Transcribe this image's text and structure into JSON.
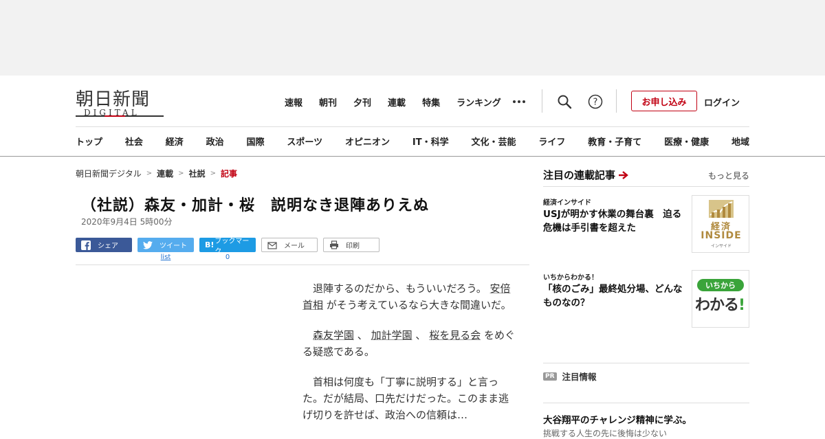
{
  "header": {
    "logo_kanji": "朝日新聞",
    "logo_sub": "DIGITAL",
    "top_nav": [
      "速報",
      "朝刊",
      "夕刊",
      "連載",
      "特集",
      "ランキング"
    ],
    "apply_label": "お申し込み",
    "login_label": "ログイン"
  },
  "category_nav": [
    "トップ",
    "社会",
    "経済",
    "政治",
    "国際",
    "スポーツ",
    "オピニオン",
    "IT・科学",
    "文化・芸能",
    "ライフ",
    "教育・子育て",
    "医療・健康",
    "地域"
  ],
  "breadcrumb": {
    "home": "朝日新聞デジタル",
    "serial": "連載",
    "editorial": "社説",
    "current": "記事"
  },
  "article": {
    "title": "（社説）森友・加計・桜　説明なき退陣ありえぬ",
    "date": "2020年9月4日 5時00分",
    "paragraph1_pre": "退陣するのだから、もういいだろう。",
    "paragraph1_link": "安倍首相",
    "paragraph1_post": "がそう考えているなら大きな間違いだ。",
    "paragraph2_link1": "森友学園",
    "paragraph2_sep1": "、",
    "paragraph2_link2": "加計学園",
    "paragraph2_sep2": "、",
    "paragraph2_link3": "桜を見る会",
    "paragraph2_post": "をめぐる疑惑である。",
    "paragraph3": "首相は何度も「丁寧に説明する」と言った。だが結局、口先だけだった。このまま逃げ切りを許せば、政治への信頼は…"
  },
  "share": {
    "facebook": "シェア",
    "twitter": "ツイート",
    "hatena": "ブックマーク",
    "mail": "メール",
    "print": "印刷",
    "twitter_count": "list",
    "hatena_count": "0"
  },
  "sidebar": {
    "heading": "注目の連載記事",
    "more": "もっと見る",
    "cards": [
      {
        "kicker": "経済インサイド",
        "title": "USJが明かす休業の舞台裏　迫る危機は手引書を超えた",
        "thumb_main": "経済",
        "thumb_sub": "INSIDE",
        "thumb_caption": "インサイド"
      },
      {
        "kicker": "いちからわかる！",
        "title": "「核のごみ」最終処分場、どんなものなの？",
        "thumb_top": "いちから",
        "thumb_main": "わかる",
        "thumb_excl": "!"
      }
    ],
    "pr_badge": "PR",
    "pr_label": "注目情報",
    "pr_title": "大谷翔平のチャレンジ精神に学ぶ。",
    "pr_desc": "挑戦する人生の先に後悔は少ない"
  }
}
